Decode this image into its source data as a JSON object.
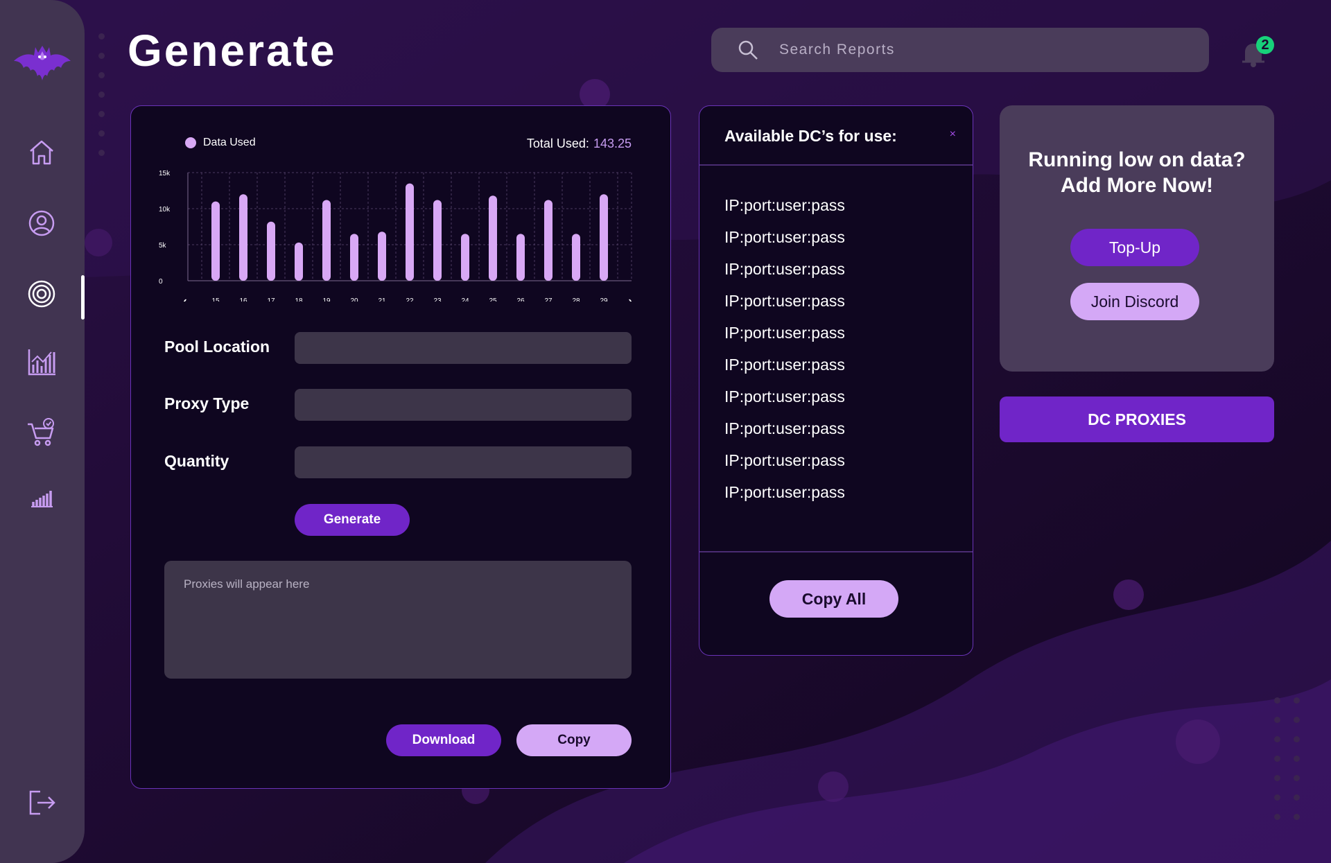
{
  "page": {
    "title": "Generate"
  },
  "search": {
    "placeholder": "Search Reports"
  },
  "notifications": {
    "count": "2"
  },
  "sidebar": {
    "items": [
      {
        "name": "home",
        "icon": "home-icon"
      },
      {
        "name": "profile",
        "icon": "user-icon"
      },
      {
        "name": "generate",
        "icon": "target-icon",
        "active": true
      },
      {
        "name": "analytics",
        "icon": "chart-icon"
      },
      {
        "name": "shop",
        "icon": "cart-icon"
      },
      {
        "name": "usage",
        "icon": "bars-icon"
      },
      {
        "name": "logout",
        "icon": "logout-icon"
      }
    ]
  },
  "chart_data": {
    "type": "bar",
    "legend": "Data Used",
    "total_label": "Total Used:",
    "total_value": "143.25",
    "categories": [
      "15",
      "16",
      "17",
      "18",
      "19",
      "20",
      "21",
      "22",
      "23",
      "24",
      "25",
      "26",
      "27",
      "28",
      "29"
    ],
    "values": [
      11000,
      12000,
      8200,
      5300,
      11200,
      6500,
      6800,
      13500,
      11200,
      6500,
      11800,
      6500,
      11200,
      6500,
      12000
    ],
    "ylim": [
      0,
      15000
    ],
    "yticks": [
      "15k",
      "10k",
      "5k",
      "0"
    ],
    "prev_label": "‹",
    "next_label": "›",
    "grid": true,
    "bar_color": "#d8a8f5"
  },
  "form": {
    "pool_label": "Pool Location",
    "pool_value": "",
    "proxy_label": "Proxy Type",
    "proxy_value": "",
    "quantity_label": "Quantity",
    "quantity_value": "",
    "generate_label": "Generate",
    "output_placeholder": "Proxies will appear here",
    "download_label": "Download",
    "copy_label": "Copy"
  },
  "dc_panel": {
    "title": "Available DC’s for use:",
    "close": "×",
    "items": [
      "IP:port:user:pass",
      "IP:port:user:pass",
      "IP:port:user:pass",
      "IP:port:user:pass",
      "IP:port:user:pass",
      "IP:port:user:pass",
      "IP:port:user:pass",
      "IP:port:user:pass",
      "IP:port:user:pass",
      "IP:port:user:pass"
    ],
    "copy_all_label": "Copy All"
  },
  "promo": {
    "line1": "Running low on data?",
    "line2": "Add More Now!",
    "topup_label": "Top-Up",
    "discord_label": "Join Discord"
  },
  "dc_proxies_label": "DC PROXIES",
  "colors": {
    "accent": "#7025c8",
    "accent_light": "#d4a8f6",
    "badge": "#17d17a",
    "panel_border": "#6a33b8"
  }
}
